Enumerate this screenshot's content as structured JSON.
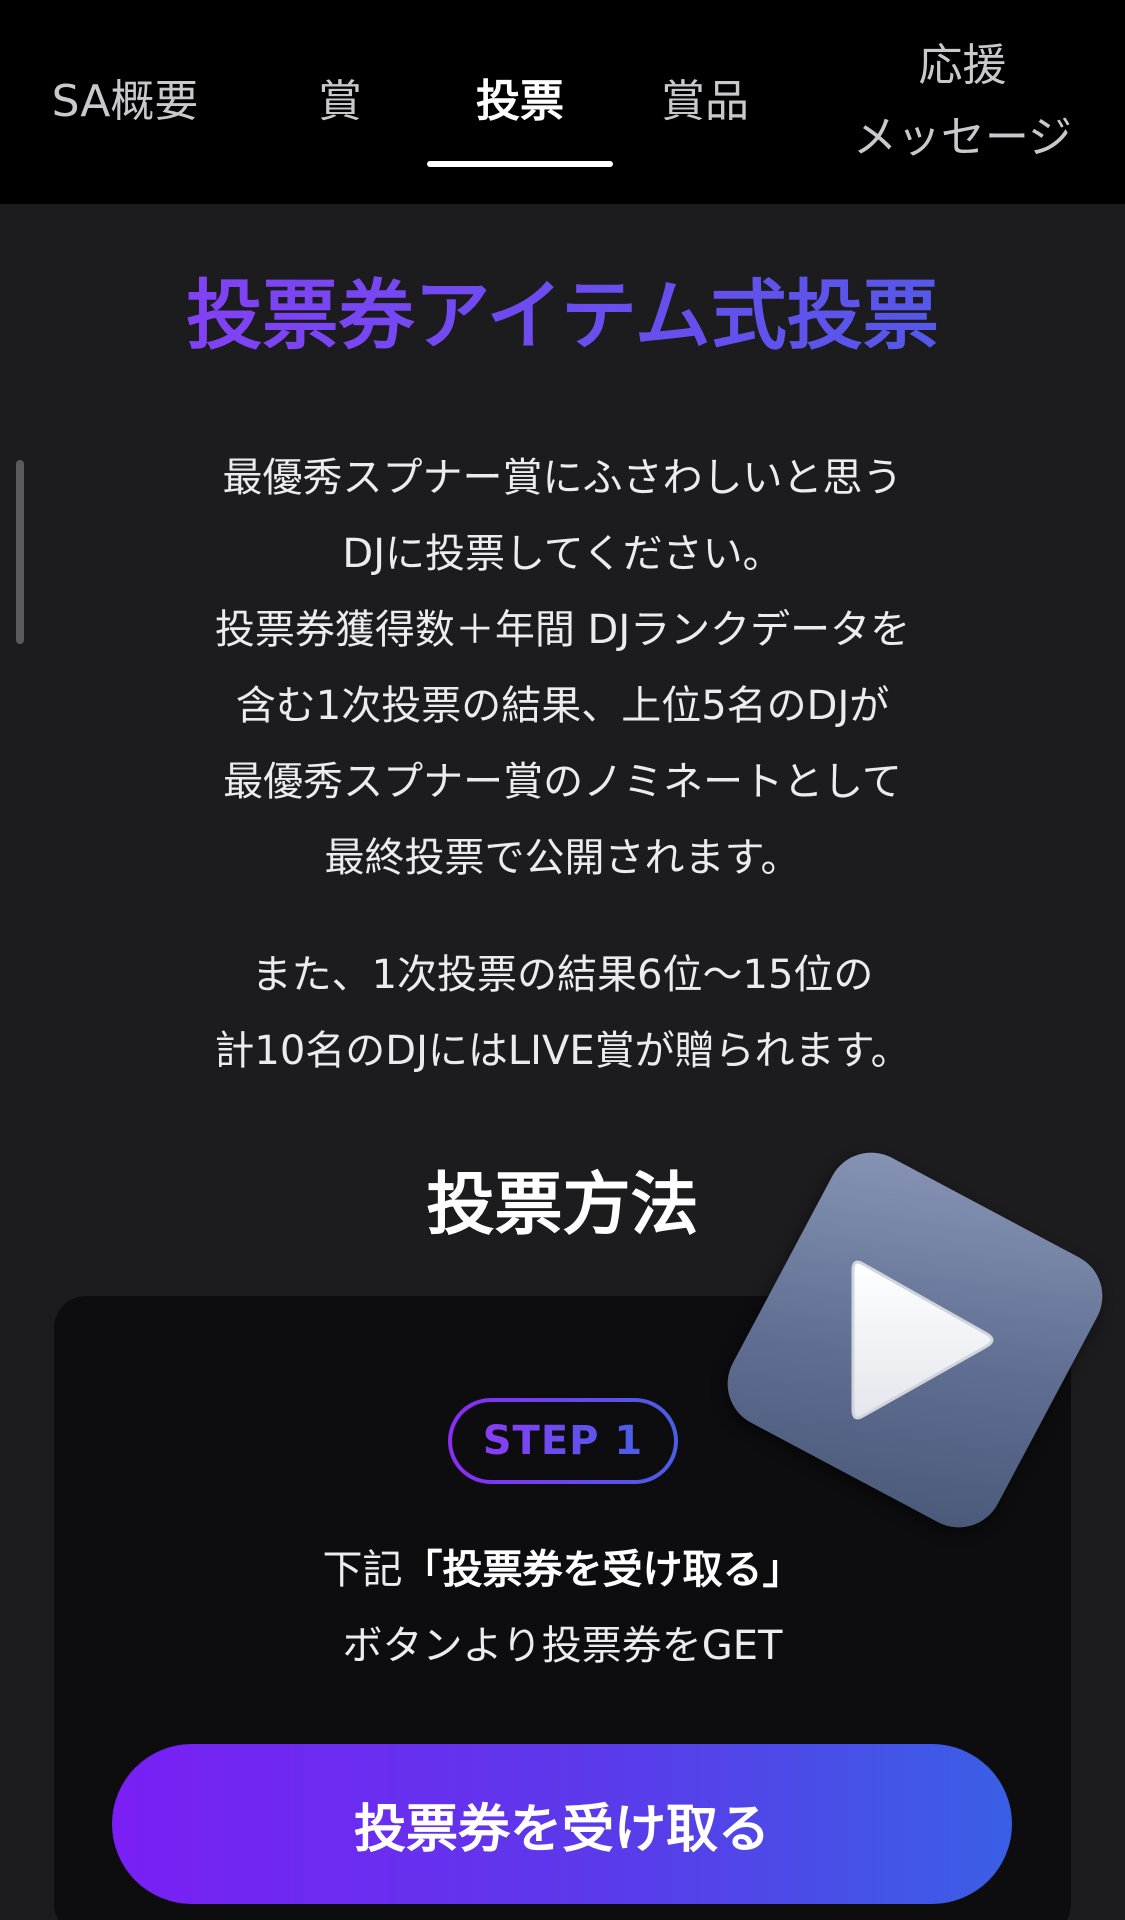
{
  "tabs": [
    {
      "label": "SA概要"
    },
    {
      "label": "賞"
    },
    {
      "label": "投票",
      "active": true
    },
    {
      "label": "賞品"
    },
    {
      "label_line1": "応援",
      "label_line2": "メッセージ"
    }
  ],
  "main": {
    "title": "投票券アイテム式投票",
    "description_lines": [
      "最優秀スプナー賞にふさわしいと思う",
      "DJに投票してください。",
      "投票券獲得数＋年間 DJランクデータを",
      "含む1次投票の結果、上位5名のDJが",
      "最優秀スプナー賞のノミネートとして",
      "最終投票で公開されます。"
    ],
    "description2_lines": [
      "また、1次投票の結果6位〜15位の",
      "計10名のDJにはLIVE賞が贈られます。"
    ],
    "section_title": "投票方法",
    "step": {
      "badge": "STEP 1",
      "text_prefix": "下記",
      "text_bold": "「投票券を受け取る」",
      "text_line2": "ボタンより投票券をGET"
    },
    "cta_label": "投票券を受け取る"
  },
  "colors": {
    "accent_purple": "#8b2cf6",
    "accent_blue": "#4a5ee6",
    "background": "#1c1b1d",
    "tabbar": "#000000"
  },
  "icons": {
    "overlay": "play-icon"
  }
}
